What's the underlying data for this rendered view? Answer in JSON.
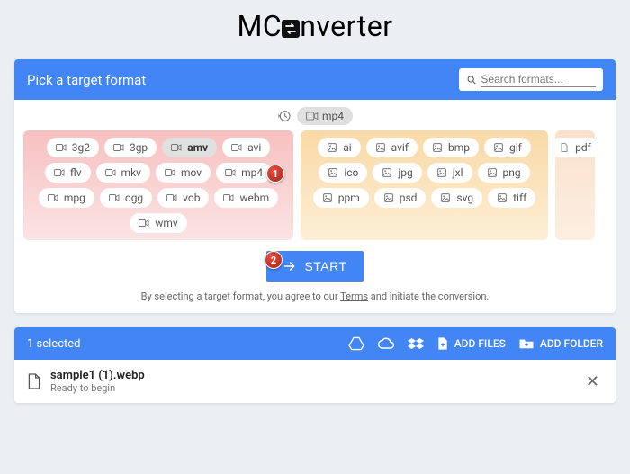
{
  "logo": {
    "left": "MC",
    "right": "nverter"
  },
  "header": {
    "title": "Pick a target format",
    "search_placeholder": "Search formats..."
  },
  "recent": {
    "label": "mp4"
  },
  "groups": {
    "video": [
      "3g2",
      "3gp",
      "amv",
      "avi",
      "flv",
      "mkv",
      "mov",
      "mp4",
      "mpg",
      "ogg",
      "vob",
      "webm",
      "wmv"
    ],
    "image": [
      "ai",
      "avif",
      "bmp",
      "gif",
      "ico",
      "jpg",
      "jxl",
      "png",
      "ppm",
      "psd",
      "svg",
      "tiff"
    ],
    "doc": [
      "pdf"
    ]
  },
  "selected_format": "amv",
  "badges": {
    "one": "1",
    "two": "2"
  },
  "start": {
    "label": "START"
  },
  "terms": {
    "prefix": "By selecting a target format, you agree to our ",
    "link": "Terms",
    "suffix": " and initiate the conversion."
  },
  "files_bar": {
    "selected": "1 selected",
    "add_files": "ADD FILES",
    "add_folder": "ADD FOLDER"
  },
  "file": {
    "name": "sample1 (1).webp",
    "status": "Ready to begin"
  }
}
